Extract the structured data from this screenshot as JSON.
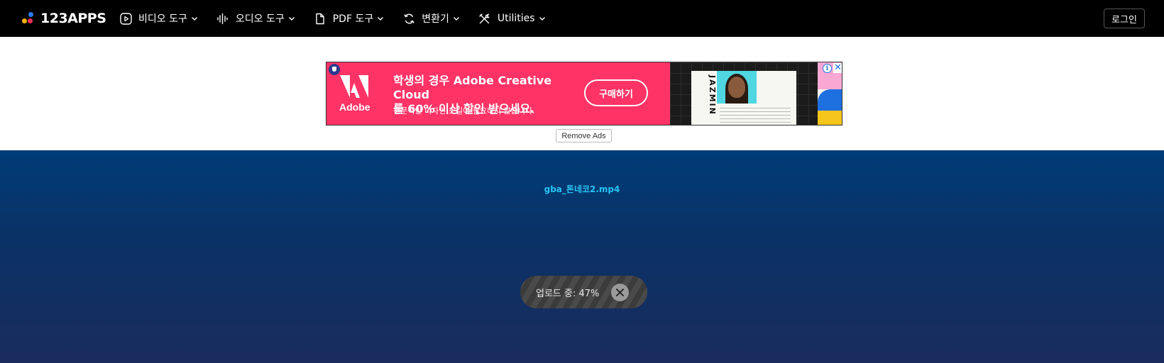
{
  "brand": {
    "name": "123APPS"
  },
  "nav": {
    "items": [
      {
        "label": "비디오 도구",
        "icon": "video-play-icon"
      },
      {
        "label": "오디오 도구",
        "icon": "audio-wave-icon"
      },
      {
        "label": "PDF 도구",
        "icon": "document-icon"
      },
      {
        "label": "변환기",
        "icon": "convert-cycle-icon"
      },
      {
        "label": "Utilities",
        "icon": "tools-icon"
      }
    ],
    "login_label": "로그인"
  },
  "ad": {
    "brand": "Adobe",
    "headline_line1": "학생의 경우 Adobe Creative Cloud",
    "headline_line2": "를 60% 이상 할인 받으세요.",
    "subtext": "전문적인 디자인 스킬이 필요하지 않습니다.",
    "cta_label": "구매하기",
    "image_text": "JAZMIN",
    "info_symbol": "i",
    "close_symbol": "✕",
    "accent_color": "#ff3366"
  },
  "remove_ads_label": "Remove Ads",
  "upload": {
    "filename": "gba_톤네코2.mp4",
    "status_text": "업로드 중: 47%",
    "progress_percent": 47,
    "cancel_icon": "close-icon"
  },
  "colors": {
    "topbar": "#000000",
    "filename": "#27c4f5",
    "main_bg_top": "#003c78",
    "main_bg_bottom": "#1a2c5e"
  }
}
